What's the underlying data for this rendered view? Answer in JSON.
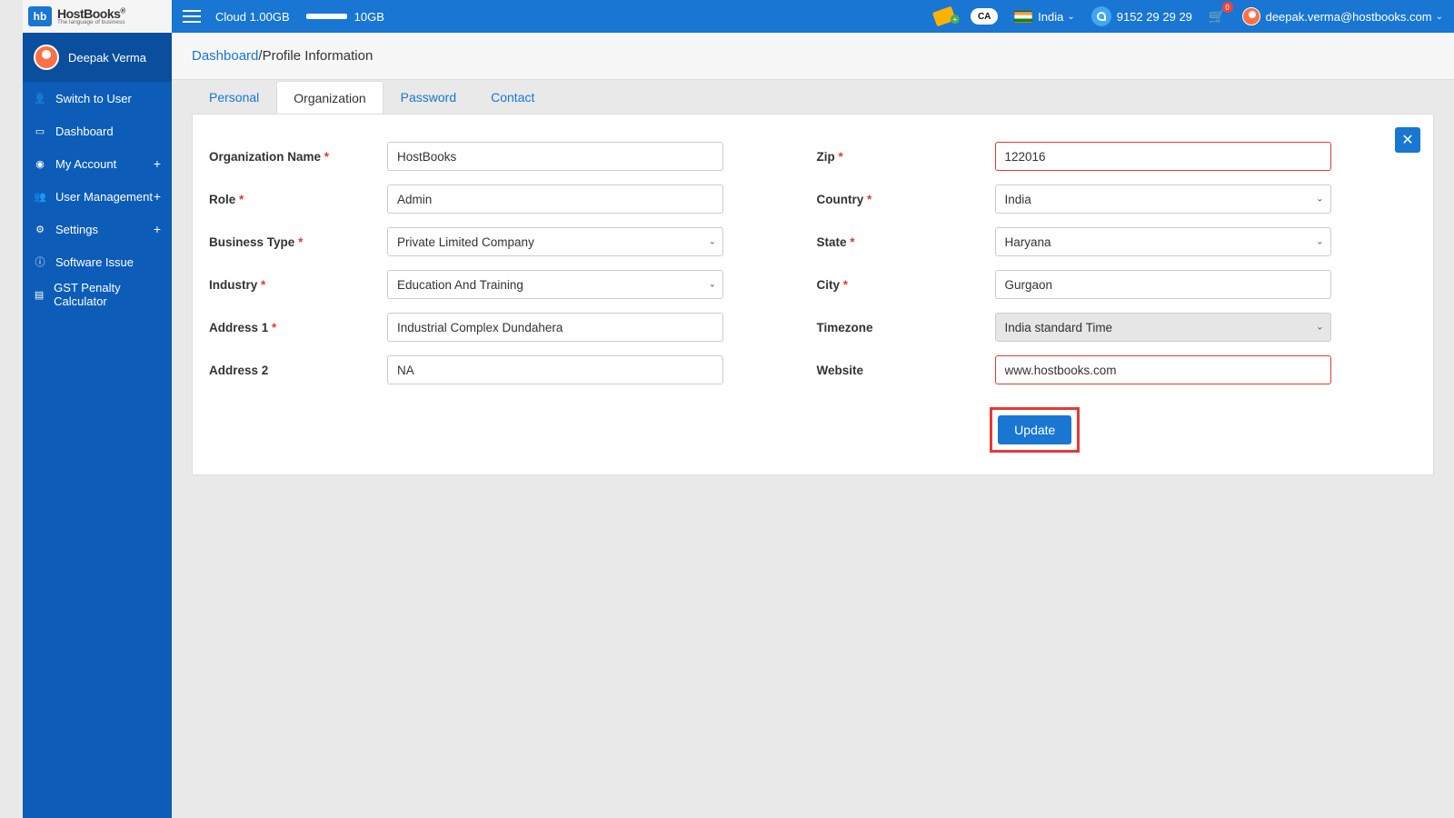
{
  "logo": {
    "abbrev": "hb",
    "title": "HostBooks",
    "tag": "The language of business",
    "trademark": "®"
  },
  "topbar": {
    "cloud_label": "Cloud 1.00GB",
    "storage_total": "10GB",
    "country": "India",
    "phone": "9152 29 29 29",
    "cart_count": "0",
    "email": "deepak.verma@hostbooks.com",
    "ca_label": "CA"
  },
  "sidebar": {
    "user_name": "Deepak Verma",
    "items": [
      {
        "icon": "👤",
        "label": "Switch to User",
        "plus": false
      },
      {
        "icon": "▭",
        "label": "Dashboard",
        "plus": false
      },
      {
        "icon": "◉",
        "label": "My Account",
        "plus": true
      },
      {
        "icon": "👥",
        "label": "User Management",
        "plus": true
      },
      {
        "icon": "⚙",
        "label": "Settings",
        "plus": true
      },
      {
        "icon": "ⓘ",
        "label": "Software Issue",
        "plus": false
      },
      {
        "icon": "▤",
        "label": "GST Penalty Calculator",
        "plus": false
      }
    ]
  },
  "breadcrumb": {
    "root": "Dashboard",
    "sep": " / ",
    "current": "Profile Information"
  },
  "tabs": {
    "t0": "Personal",
    "t1": "Organization",
    "t2": "Password",
    "t3": "Contact"
  },
  "form": {
    "labels": {
      "org_name": "Organization Name",
      "role": "Role",
      "biz_type": "Business Type",
      "industry": "Industry",
      "addr1": "Address 1",
      "addr2": "Address 2",
      "zip": "Zip",
      "country": "Country",
      "state": "State",
      "city": "City",
      "timezone": "Timezone",
      "website": "Website"
    },
    "values": {
      "org_name": "HostBooks",
      "role": "Admin",
      "biz_type": "Private Limited Company",
      "industry": "Education And Training",
      "addr1": "Industrial Complex Dundahera",
      "addr2": "NA",
      "zip": "122016",
      "country": "India",
      "state": "Haryana",
      "city": "Gurgaon",
      "timezone": "India standard Time",
      "website": "www.hostbooks.com"
    },
    "update_label": "Update"
  }
}
